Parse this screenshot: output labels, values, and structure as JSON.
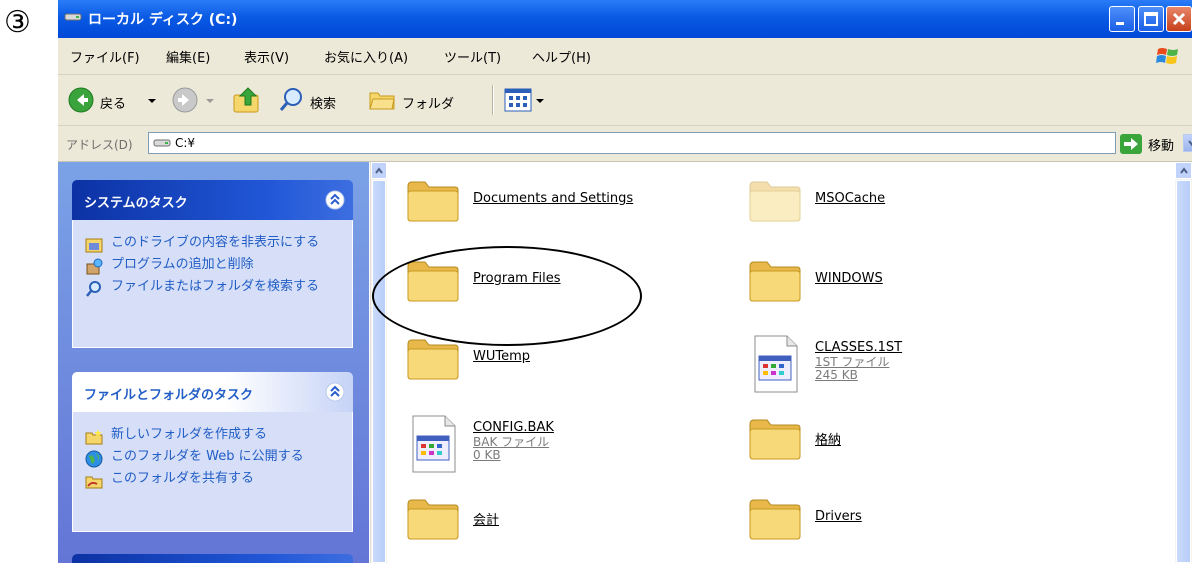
{
  "step_marker": "③",
  "window": {
    "title": "ローカル ディスク (C:)"
  },
  "menubar": {
    "items": [
      {
        "label": "ファイル(F)"
      },
      {
        "label": "編集(E)"
      },
      {
        "label": "表示(V)"
      },
      {
        "label": "お気に入り(A)"
      },
      {
        "label": "ツール(T)"
      },
      {
        "label": "ヘルプ(H)"
      }
    ]
  },
  "toolbar": {
    "back_label": "戻る",
    "search_label": "検索",
    "folders_label": "フォルダ"
  },
  "addressbar": {
    "label": "アドレス(D)",
    "value": "C:¥",
    "go_label": "移動"
  },
  "taskpane": {
    "system_tasks": {
      "title": "システムのタスク",
      "items": [
        {
          "label": "このドライブの内容を非表示にする",
          "icon": "hide-contents-icon"
        },
        {
          "label": "プログラムの追加と削除",
          "icon": "add-remove-programs-icon"
        },
        {
          "label": "ファイルまたはフォルダを検索する",
          "icon": "search-icon"
        }
      ]
    },
    "file_tasks": {
      "title": "ファイルとフォルダのタスク",
      "items": [
        {
          "label": "新しいフォルダを作成する",
          "icon": "new-folder-icon"
        },
        {
          "label": "このフォルダを Web に公開する",
          "icon": "publish-web-icon"
        },
        {
          "label": "このフォルダを共有する",
          "icon": "share-folder-icon"
        }
      ]
    }
  },
  "files": [
    {
      "name": "Documents and Settings",
      "type": "folder"
    },
    {
      "name": "MSOCache",
      "type": "folder-hidden"
    },
    {
      "name": "Program Files",
      "type": "folder"
    },
    {
      "name": "WINDOWS",
      "type": "folder"
    },
    {
      "name": "WUTemp",
      "type": "folder"
    },
    {
      "name": "CLASSES.1ST",
      "type": "file",
      "kind": "1ST ファイル",
      "size": "245 KB"
    },
    {
      "name": "CONFIG.BAK",
      "type": "file",
      "kind": "BAK ファイル",
      "size": "0 KB"
    },
    {
      "name": "格納",
      "type": "folder"
    },
    {
      "name": "会計",
      "type": "folder"
    },
    {
      "name": "Drivers",
      "type": "folder"
    }
  ],
  "colors": {
    "title_blue": "#0a5ae4",
    "task_link": "#215dc6",
    "task_bg": "#d6dff7",
    "pane_bg": "#7ba2e7",
    "folder_yellow": "#f5d66b"
  }
}
